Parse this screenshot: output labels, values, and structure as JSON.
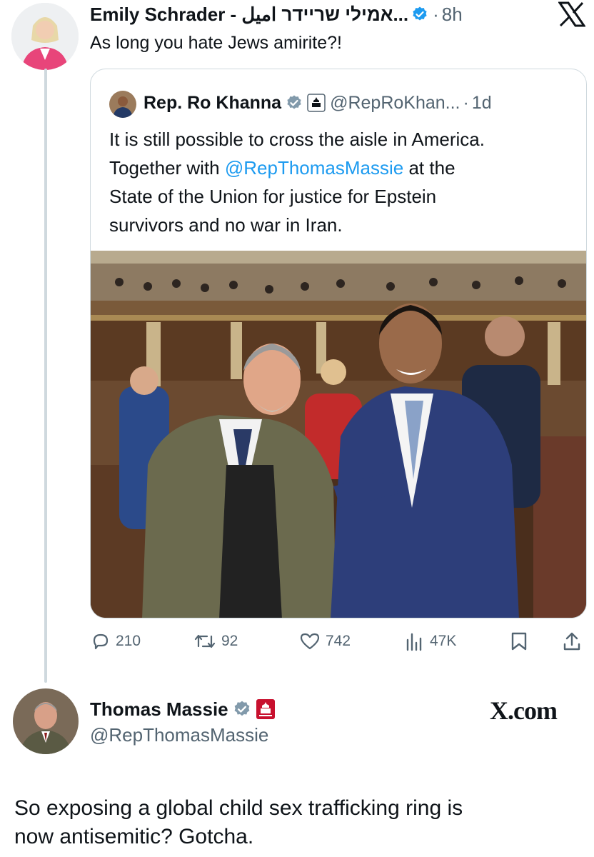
{
  "top_tweet": {
    "author_name": "Emily Schrader - אמילי שריידר اميل...",
    "timestamp": "8h",
    "text": "As long you hate Jews amirite?!"
  },
  "quoted_tweet": {
    "author_name": "Rep. Ro Khanna",
    "handle": "@RepRoKhan...",
    "timestamp": "1d",
    "text_line1": "It is still possible to cross the aisle in America.",
    "text_line2_prefix": "Together with ",
    "text_mention": "@RepThomasMassie",
    "text_line2_suffix": " at the",
    "text_line3": "State of the Union for justice for Epstein",
    "text_line4": "survivors and no war in Iran."
  },
  "actions": {
    "replies": "210",
    "reposts": "92",
    "likes": "742",
    "views": "47K"
  },
  "bottom_post": {
    "author_name": "Thomas Massie",
    "handle": "@RepThomasMassie",
    "brand": "X.com",
    "text_line1": "So exposing a global child sex trafficking ring is",
    "text_line2": "now antisemitic? Gotcha."
  },
  "colors": {
    "accent": "#1d9bf0",
    "muted": "#536471",
    "border": "#cfd9de",
    "congress_red": "#c8102e"
  },
  "icons": [
    "verified-badge-icon",
    "x-logo-icon",
    "capitol-badge-icon",
    "reply-icon",
    "repost-icon",
    "like-icon",
    "views-icon",
    "bookmark-icon",
    "share-icon"
  ]
}
